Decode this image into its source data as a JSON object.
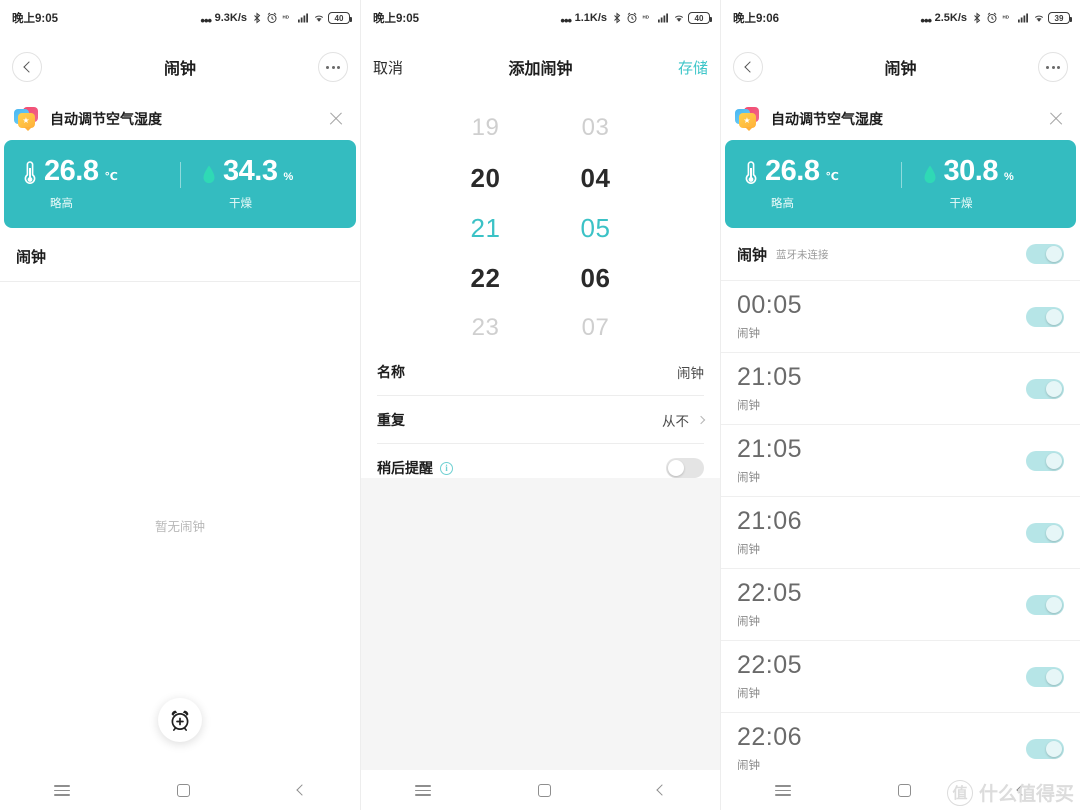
{
  "panels": [
    {
      "id": "alarm-empty",
      "status": {
        "time": "晚上9:05",
        "speed": "9.3K/s",
        "battery": "40",
        "icons": [
          "bluetooth-icon",
          "alarm-icon",
          "hd-icon",
          "signal-icon",
          "wifi-icon",
          "battery-icon"
        ]
      },
      "appbar": {
        "title": "闹钟",
        "back_icon": "chevron-left-icon",
        "more_icon": "more-options-icon"
      },
      "promo": {
        "icon": "stacked-cards-icon",
        "text": "自动调节空气湿度",
        "close_icon": "close-icon"
      },
      "sensor": {
        "temp_icon": "thermometer-icon",
        "temp_value": "26.8",
        "temp_unit": "℃",
        "temp_status": "略高",
        "hum_icon": "water-drop-icon",
        "hum_value": "34.3",
        "hum_unit": "%",
        "hum_status": "干燥"
      },
      "section_title": "闹钟",
      "empty_text": "暂无闹钟",
      "fab": {
        "icon": "alarm-add-icon"
      }
    },
    {
      "id": "add-alarm",
      "status": {
        "time": "晚上9:05",
        "speed": "1.1K/s",
        "battery": "40"
      },
      "appbar": {
        "cancel_label": "取消",
        "title": "添加闹钟",
        "save_label": "存储"
      },
      "picker": {
        "hours": [
          "19",
          "20",
          "21",
          "22",
          "23"
        ],
        "minutes": [
          "03",
          "04",
          "05",
          "06",
          "07"
        ],
        "selected_hour": "21",
        "selected_minute": "05"
      },
      "rows": [
        {
          "label": "名称",
          "value": "闹钟",
          "type": "value"
        },
        {
          "label": "重复",
          "value": "从不",
          "type": "nav"
        },
        {
          "label": "稍后提醒",
          "value": "",
          "type": "toggle",
          "toggle_on": false,
          "info_icon": "info-icon"
        }
      ]
    },
    {
      "id": "alarm-list",
      "status": {
        "time": "晚上9:06",
        "speed": "2.5K/s",
        "battery": "39"
      },
      "appbar": {
        "title": "闹钟",
        "back_icon": "chevron-left-icon",
        "more_icon": "more-options-icon"
      },
      "promo": {
        "icon": "stacked-cards-icon",
        "text": "自动调节空气湿度",
        "close_icon": "close-icon"
      },
      "sensor": {
        "temp_icon": "thermometer-icon",
        "temp_value": "26.8",
        "temp_unit": "℃",
        "temp_status": "略高",
        "hum_icon": "water-drop-icon",
        "hum_value": "30.8",
        "hum_unit": "%",
        "hum_status": "干燥"
      },
      "list_head": {
        "title": "闹钟",
        "subtitle": "蓝牙未连接",
        "toggle_on": true
      },
      "alarms": [
        {
          "time": "00:05",
          "label": "闹钟",
          "on": true
        },
        {
          "time": "21:05",
          "label": "闹钟",
          "on": true
        },
        {
          "time": "21:05",
          "label": "闹钟",
          "on": true
        },
        {
          "time": "21:06",
          "label": "闹钟",
          "on": true
        },
        {
          "time": "22:05",
          "label": "闹钟",
          "on": true
        },
        {
          "time": "22:05",
          "label": "闹钟",
          "on": true
        },
        {
          "time": "22:06",
          "label": "闹钟",
          "on": true
        }
      ]
    }
  ],
  "navbar": {
    "menu_icon": "menu-icon",
    "home_icon": "home-icon",
    "back_icon": "back-icon"
  },
  "watermark": {
    "badge": "值",
    "text": "什么值得买"
  },
  "colors": {
    "accent": "#34bcc0",
    "accent_text": "#3ec6c9",
    "toggle_on": "#b6e5e7",
    "drop": "#2fd9b5"
  }
}
